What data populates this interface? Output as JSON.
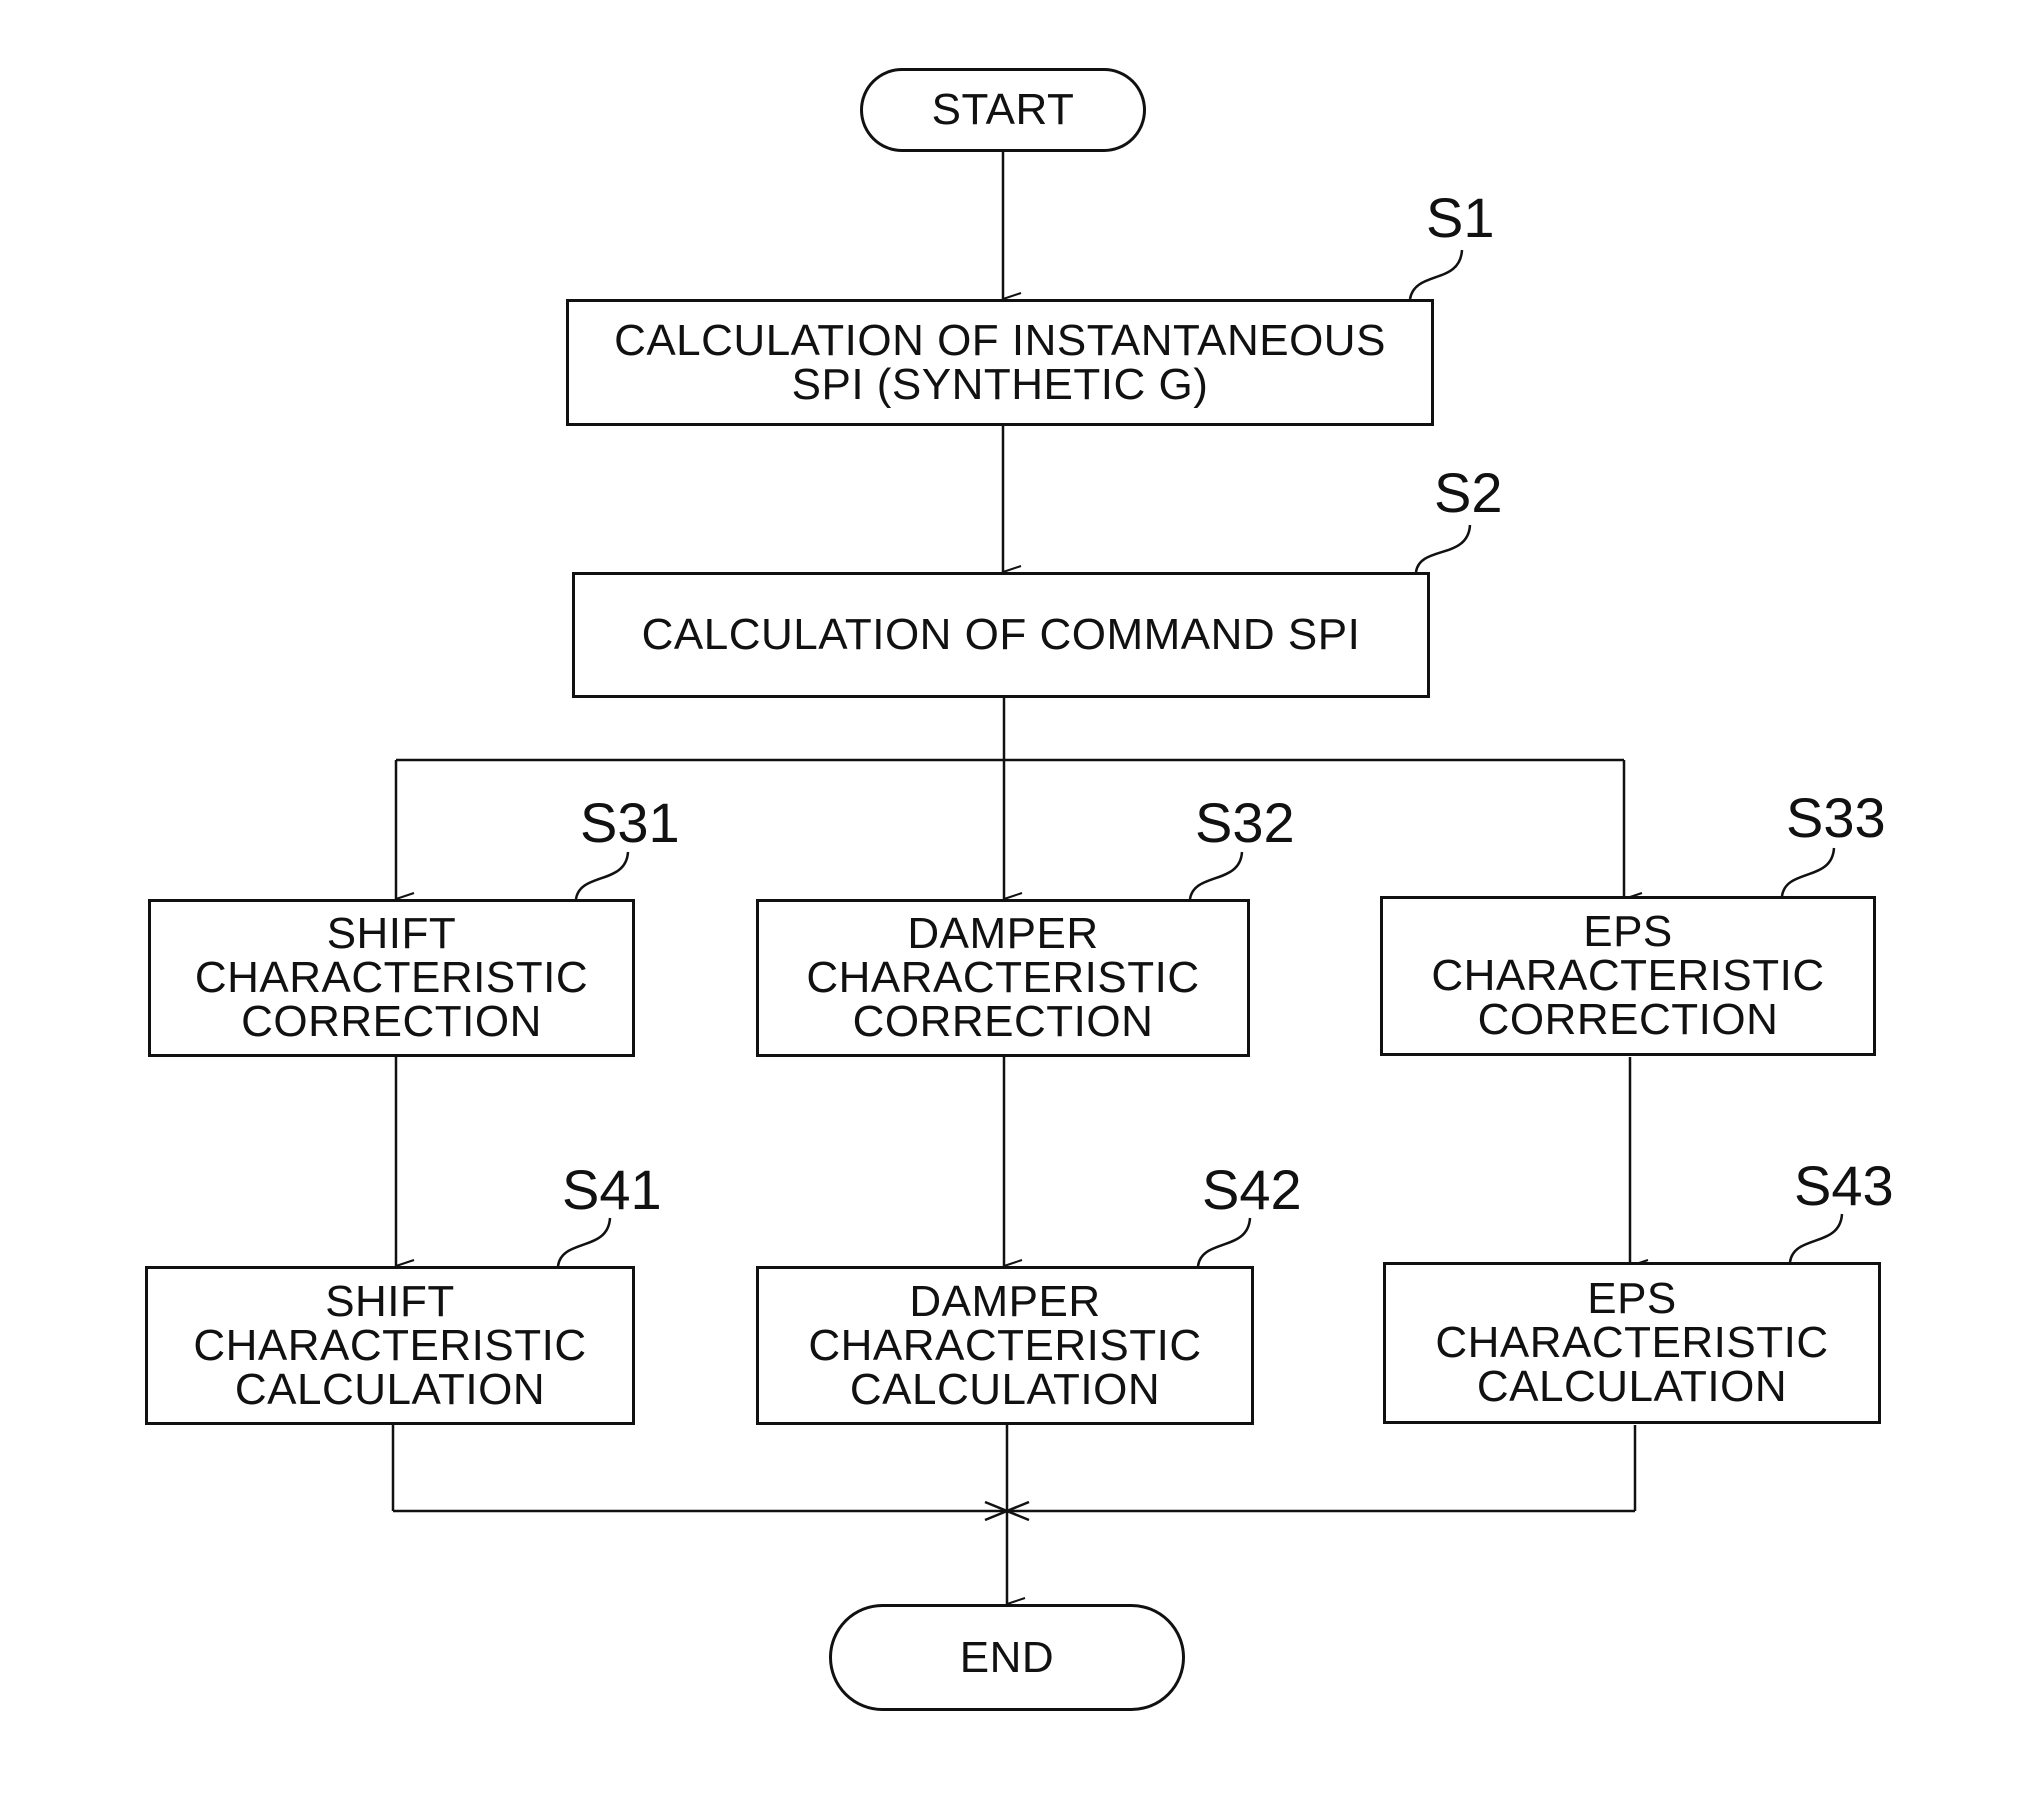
{
  "diagram": {
    "type": "flowchart",
    "start": {
      "text": "START"
    },
    "end": {
      "text": "END"
    },
    "steps": [
      {
        "id": "S1",
        "text": "CALCULATION OF INSTANTANEOUS\nSPI (SYNTHETIC G)"
      },
      {
        "id": "S2",
        "text": "CALCULATION OF COMMAND SPI"
      },
      {
        "id": "S31",
        "text": "SHIFT\nCHARACTERISTIC\nCORRECTION"
      },
      {
        "id": "S32",
        "text": "DAMPER\nCHARACTERISTIC\nCORRECTION"
      },
      {
        "id": "S33",
        "text": "EPS\nCHARACTERISTIC\nCORRECTION"
      },
      {
        "id": "S41",
        "text": "SHIFT\nCHARACTERISTIC\nCALCULATION"
      },
      {
        "id": "S42",
        "text": "DAMPER\nCHARACTERISTIC\nCALCULATION"
      },
      {
        "id": "S43",
        "text": "EPS\nCHARACTERISTIC\nCALCULATION"
      }
    ],
    "edges": [
      [
        "START",
        "S1"
      ],
      [
        "S1",
        "S2"
      ],
      [
        "S2",
        "S31"
      ],
      [
        "S2",
        "S32"
      ],
      [
        "S2",
        "S33"
      ],
      [
        "S31",
        "S41"
      ],
      [
        "S32",
        "S42"
      ],
      [
        "S33",
        "S43"
      ],
      [
        "S41",
        "END"
      ],
      [
        "S42",
        "END"
      ],
      [
        "S43",
        "END"
      ]
    ]
  }
}
